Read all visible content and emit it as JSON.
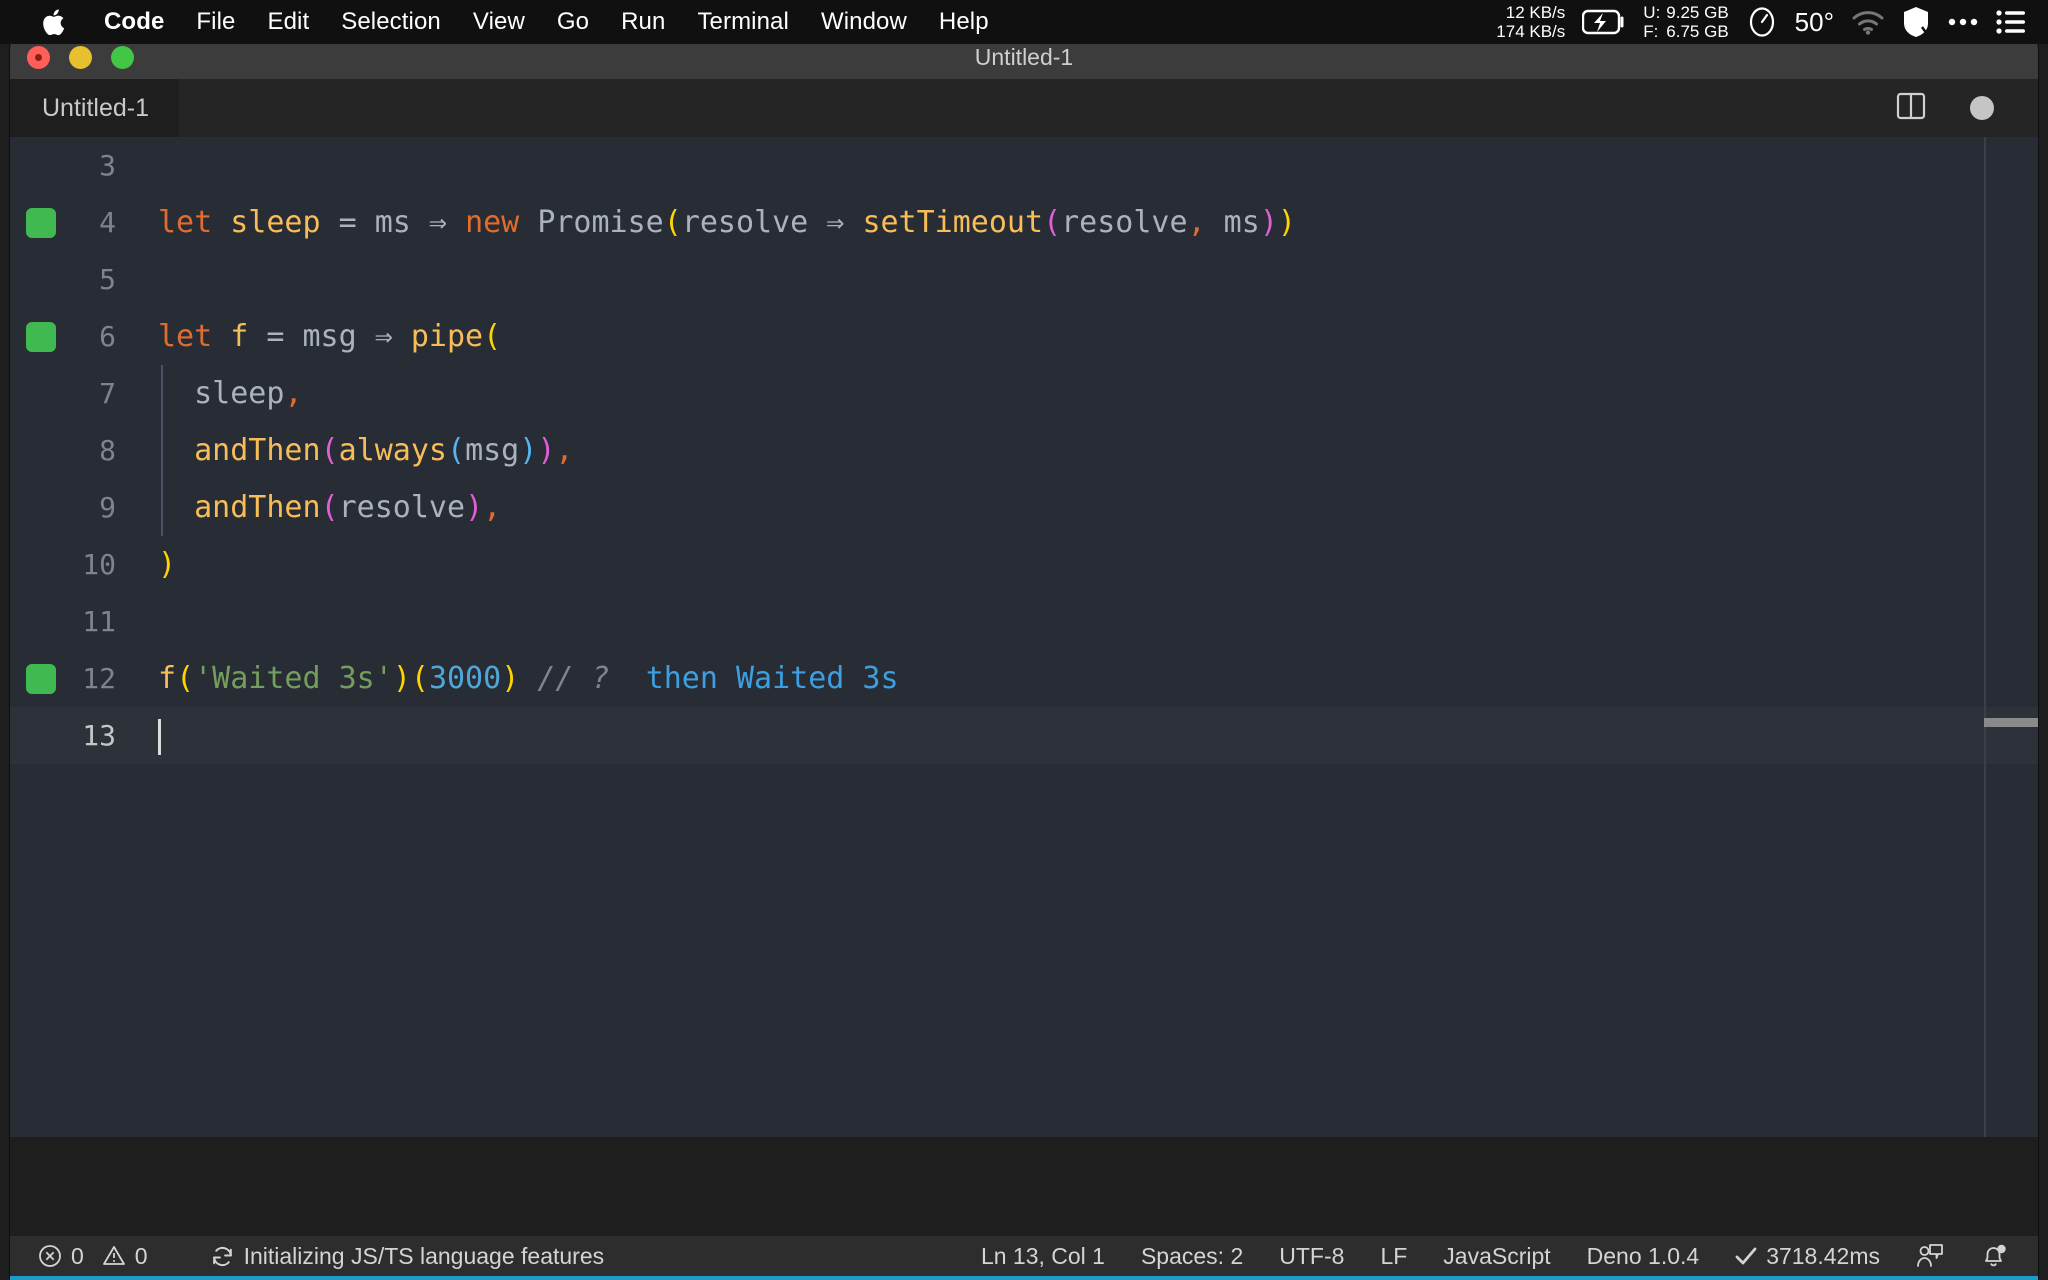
{
  "menubar": {
    "apple_icon": "apple-logo",
    "items": [
      {
        "label": "Code",
        "bold": true
      },
      {
        "label": "File",
        "bold": false
      },
      {
        "label": "Edit",
        "bold": false
      },
      {
        "label": "Selection",
        "bold": false
      },
      {
        "label": "View",
        "bold": false
      },
      {
        "label": "Go",
        "bold": false
      },
      {
        "label": "Run",
        "bold": false
      },
      {
        "label": "Terminal",
        "bold": false
      },
      {
        "label": "Window",
        "bold": false
      },
      {
        "label": "Help",
        "bold": false
      }
    ],
    "status": {
      "net_up": "12 KB/s",
      "net_down": "174 KB/s",
      "battery_icon": "battery-charging-icon",
      "mem_used_label": "U:",
      "mem_used_value": "9.25 GB",
      "mem_free_label": "F:",
      "mem_free_value": "6.75 GB",
      "clock_icon": "clock-icon",
      "temperature": "50°",
      "wifi_icon": "wifi-icon",
      "shield_icon": "shield-icon",
      "more_icon": "ellipsis-icon",
      "list_icon": "control-center-icon"
    }
  },
  "window": {
    "title": "Untitled-1",
    "traffic_lights": [
      "close",
      "minimize",
      "zoom"
    ]
  },
  "tabbar": {
    "tabs": [
      {
        "label": "Untitled-1",
        "active": true,
        "dirty": true
      }
    ],
    "split_editor_icon": "split-editor-icon",
    "more_actions_icon": "dirty-dot-icon"
  },
  "editor": {
    "lines": [
      {
        "num": "3",
        "breakpoint": false,
        "current": false,
        "indent_guide": false,
        "tokens": []
      },
      {
        "num": "4",
        "breakpoint": true,
        "current": false,
        "indent_guide": false,
        "tokens": [
          {
            "t": "let ",
            "c": "t-kw"
          },
          {
            "t": "sleep",
            "c": "t-fn"
          },
          {
            "t": " ",
            "c": "t-var"
          },
          {
            "t": "=",
            "c": "t-op"
          },
          {
            "t": " ",
            "c": "t-var"
          },
          {
            "t": "ms",
            "c": "t-var"
          },
          {
            "t": " ⇒ ",
            "c": "t-op"
          },
          {
            "t": "new",
            "c": "t-kw"
          },
          {
            "t": " ",
            "c": "t-var"
          },
          {
            "t": "Promise",
            "c": "t-var"
          },
          {
            "t": "(",
            "c": "t-b1"
          },
          {
            "t": "resolve",
            "c": "t-var"
          },
          {
            "t": " ⇒ ",
            "c": "t-op"
          },
          {
            "t": "setTimeout",
            "c": "t-fn"
          },
          {
            "t": "(",
            "c": "t-b2"
          },
          {
            "t": "resolve",
            "c": "t-var"
          },
          {
            "t": ",",
            "c": "t-punc"
          },
          {
            "t": " ms",
            "c": "t-var"
          },
          {
            "t": ")",
            "c": "t-b2"
          },
          {
            "t": ")",
            "c": "t-b1"
          }
        ]
      },
      {
        "num": "5",
        "breakpoint": false,
        "current": false,
        "indent_guide": false,
        "tokens": []
      },
      {
        "num": "6",
        "breakpoint": true,
        "current": false,
        "indent_guide": false,
        "tokens": [
          {
            "t": "let ",
            "c": "t-kw"
          },
          {
            "t": "f",
            "c": "t-fn"
          },
          {
            "t": " ",
            "c": "t-var"
          },
          {
            "t": "=",
            "c": "t-op"
          },
          {
            "t": " ",
            "c": "t-var"
          },
          {
            "t": "msg",
            "c": "t-var"
          },
          {
            "t": " ⇒ ",
            "c": "t-op"
          },
          {
            "t": "pipe",
            "c": "t-fn"
          },
          {
            "t": "(",
            "c": "t-b1"
          }
        ]
      },
      {
        "num": "7",
        "breakpoint": false,
        "current": false,
        "indent_guide": true,
        "tokens": [
          {
            "t": "  sleep",
            "c": "t-var"
          },
          {
            "t": ",",
            "c": "t-punc"
          }
        ]
      },
      {
        "num": "8",
        "breakpoint": false,
        "current": false,
        "indent_guide": true,
        "tokens": [
          {
            "t": "  andThen",
            "c": "t-fn"
          },
          {
            "t": "(",
            "c": "t-b2"
          },
          {
            "t": "always",
            "c": "t-fn"
          },
          {
            "t": "(",
            "c": "t-b3"
          },
          {
            "t": "msg",
            "c": "t-var"
          },
          {
            "t": ")",
            "c": "t-b3"
          },
          {
            "t": ")",
            "c": "t-b2"
          },
          {
            "t": ",",
            "c": "t-punc"
          }
        ]
      },
      {
        "num": "9",
        "breakpoint": false,
        "current": false,
        "indent_guide": true,
        "tokens": [
          {
            "t": "  andThen",
            "c": "t-fn"
          },
          {
            "t": "(",
            "c": "t-b2"
          },
          {
            "t": "resolve",
            "c": "t-var"
          },
          {
            "t": ")",
            "c": "t-b2"
          },
          {
            "t": ",",
            "c": "t-punc"
          }
        ]
      },
      {
        "num": "10",
        "breakpoint": false,
        "current": false,
        "indent_guide": false,
        "tokens": [
          {
            "t": ")",
            "c": "t-b1"
          }
        ]
      },
      {
        "num": "11",
        "breakpoint": false,
        "current": false,
        "indent_guide": false,
        "tokens": []
      },
      {
        "num": "12",
        "breakpoint": true,
        "current": false,
        "indent_guide": false,
        "tokens": [
          {
            "t": "f",
            "c": "t-fn"
          },
          {
            "t": "(",
            "c": "t-b1"
          },
          {
            "t": "'Waited 3s'",
            "c": "t-str"
          },
          {
            "t": ")",
            "c": "t-b1"
          },
          {
            "t": "(",
            "c": "t-b1"
          },
          {
            "t": "3000",
            "c": "t-num"
          },
          {
            "t": ")",
            "c": "t-b1"
          },
          {
            "t": " ",
            "c": "t-var"
          },
          {
            "t": "// ?",
            "c": "t-com"
          },
          {
            "t": "  ",
            "c": "t-var"
          },
          {
            "t": "then Waited 3s",
            "c": "t-res"
          }
        ]
      },
      {
        "num": "13",
        "breakpoint": false,
        "current": true,
        "indent_guide": false,
        "tokens": []
      }
    ]
  },
  "statusbar": {
    "error_icon": "error-circle-icon",
    "error_count": "0",
    "warning_icon": "warning-triangle-icon",
    "warning_count": "0",
    "sync_icon": "sync-icon",
    "task_text": "Initializing JS/TS language features",
    "cursor_position": "Ln 13, Col 1",
    "indentation": "Spaces: 2",
    "encoding": "UTF-8",
    "eol": "LF",
    "language": "JavaScript",
    "runtime": "Deno 1.0.4",
    "check_icon": "check-icon",
    "run_time": "3718.42ms",
    "feedback_icon": "feedback-person-icon",
    "bell_icon": "bell-badge-icon",
    "accent_color": "#1d9bc9"
  }
}
